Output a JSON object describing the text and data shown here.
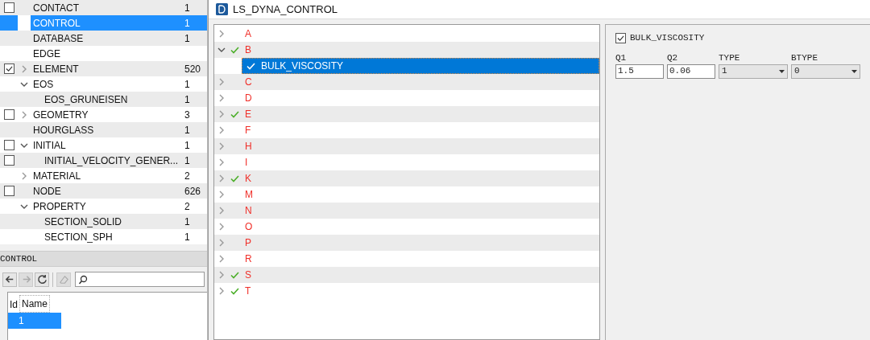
{
  "model_tree": {
    "items": [
      {
        "label": "CONTACT",
        "count": "1",
        "checked": false,
        "selected": false
      },
      {
        "label": "CONTROL",
        "count": "1",
        "selected": true
      },
      {
        "label": "DATABASE",
        "count": "1",
        "selected": false
      },
      {
        "label": "EDGE",
        "selected": false
      },
      {
        "label": "ELEMENT",
        "count": "520",
        "checked": true,
        "expanded": false,
        "selected": false
      },
      {
        "label": "EOS",
        "count": "1",
        "expanded": true,
        "selected": false,
        "children": [
          {
            "label": "EOS_GRUNEISEN",
            "count": "1",
            "selected": false
          }
        ]
      },
      {
        "label": "GEOMETRY",
        "count": "3",
        "checked": false,
        "expanded": false,
        "selected": false
      },
      {
        "label": "HOURGLASS",
        "count": "1",
        "selected": false
      },
      {
        "label": "INITIAL",
        "count": "1",
        "checked": false,
        "expanded": true,
        "selected": false,
        "children": [
          {
            "label": "INITIAL_VELOCITY_GENER...",
            "count": "1",
            "checked": false,
            "selected": false
          }
        ]
      },
      {
        "label": "MATERIAL",
        "count": "2",
        "expanded": false,
        "selected": false
      },
      {
        "label": "NODE",
        "count": "626",
        "checked": false,
        "selected": false
      },
      {
        "label": "PROPERTY",
        "count": "2",
        "expanded": true,
        "selected": false,
        "children": [
          {
            "label": "SECTION_SOLID",
            "count": "1",
            "selected": false
          },
          {
            "label": "SECTION_SPH",
            "count": "1",
            "selected": false
          }
        ]
      }
    ]
  },
  "detail_panel": {
    "title": "CONTROL",
    "toolbar": [
      {
        "kind": "back",
        "disabled": false
      },
      {
        "kind": "forward",
        "disabled": true
      },
      {
        "kind": "refresh",
        "disabled": false
      },
      {
        "kind": "erase",
        "disabled": true
      }
    ],
    "table": {
      "columns": [
        "Id",
        "Name"
      ],
      "rows": [
        {
          "cells": [
            "1",
            ""
          ],
          "selected": true
        }
      ]
    }
  },
  "dialog": {
    "title": "LS_DYNA_CONTROL",
    "groups": [
      {
        "label": "A",
        "expanded": false,
        "checked": false
      },
      {
        "label": "B",
        "expanded": true,
        "checked": true,
        "children": [
          {
            "label": "BULK_VISCOSITY",
            "checked": true,
            "selected": true
          }
        ]
      },
      {
        "label": "C",
        "expanded": false,
        "checked": false
      },
      {
        "label": "D",
        "expanded": false,
        "checked": false
      },
      {
        "label": "E",
        "expanded": false,
        "checked": true
      },
      {
        "label": "F",
        "expanded": false,
        "checked": false
      },
      {
        "label": "H",
        "expanded": false,
        "checked": false
      },
      {
        "label": "I",
        "expanded": false,
        "checked": false
      },
      {
        "label": "K",
        "expanded": false,
        "checked": true
      },
      {
        "label": "M",
        "expanded": false,
        "checked": false
      },
      {
        "label": "N",
        "expanded": false,
        "checked": false
      },
      {
        "label": "O",
        "expanded": false,
        "checked": false
      },
      {
        "label": "P",
        "expanded": false,
        "checked": false
      },
      {
        "label": "R",
        "expanded": false,
        "checked": false
      },
      {
        "label": "S",
        "expanded": false,
        "checked": true
      },
      {
        "label": "T",
        "expanded": false,
        "checked": true
      }
    ],
    "form": {
      "enable": {
        "label": "BULK_VISCOSITY",
        "checked": true
      },
      "fields": [
        {
          "label": "Q1",
          "kind": "text",
          "value": "1.5"
        },
        {
          "label": "Q2",
          "kind": "text",
          "value": "0.06"
        },
        {
          "label": "TYPE",
          "kind": "select",
          "value": "1"
        },
        {
          "label": "BTYPE",
          "kind": "select",
          "value": "0"
        }
      ]
    }
  }
}
